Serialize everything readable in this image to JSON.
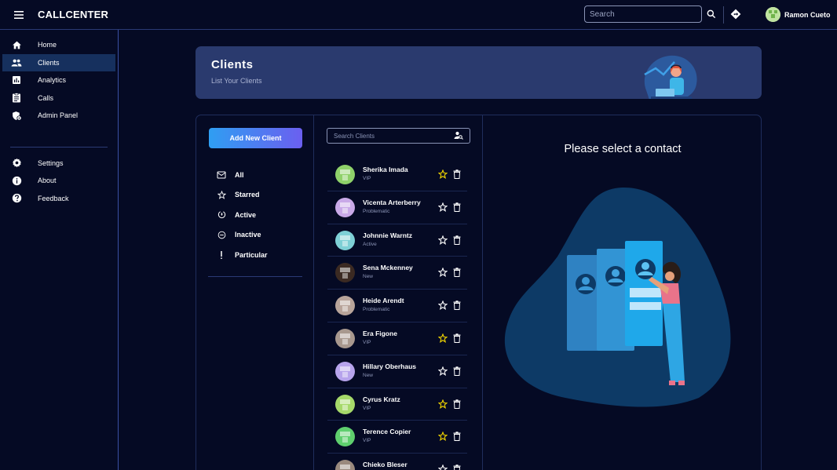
{
  "topbar": {
    "title": "CALLCENTER",
    "search_placeholder": "Search",
    "user_name": "Ramon Cueto"
  },
  "sidebar": {
    "items": [
      {
        "label": "Home",
        "icon": "home-icon"
      },
      {
        "label": "Clients",
        "icon": "people-icon",
        "active": true
      },
      {
        "label": "Analytics",
        "icon": "chart-icon"
      },
      {
        "label": "Calls",
        "icon": "clipboard-icon"
      },
      {
        "label": "Admin Panel",
        "icon": "admin-shield-icon"
      }
    ],
    "bottom_items": [
      {
        "label": "Settings",
        "icon": "gear-icon"
      },
      {
        "label": "About",
        "icon": "info-icon"
      },
      {
        "label": "Feedback",
        "icon": "help-icon"
      }
    ]
  },
  "banner": {
    "title": "Clients",
    "subtitle": "List Your Clients"
  },
  "left_panel": {
    "add_button": "Add New Client",
    "filters": [
      {
        "label": "All",
        "icon": "mail-icon"
      },
      {
        "label": "Starred",
        "icon": "star-icon"
      },
      {
        "label": "Active",
        "icon": "active-icon"
      },
      {
        "label": "Inactive",
        "icon": "minus-circle-icon"
      },
      {
        "label": "Particular",
        "icon": "exclamation-icon"
      }
    ]
  },
  "client_search_placeholder": "Search Clients",
  "clients": [
    {
      "name": "Sherika Imada",
      "status": "VIP",
      "starred": true,
      "avatar_color": "#8fd16a"
    },
    {
      "name": "Vicenta Arterberry",
      "status": "Problematic",
      "starred": false,
      "avatar_color": "#c9a9e8"
    },
    {
      "name": "Johnnie Warntz",
      "status": "Active",
      "starred": false,
      "avatar_color": "#7ed0d6"
    },
    {
      "name": "Sena Mckenney",
      "status": "New",
      "starred": false,
      "avatar_color": "#3b2a22"
    },
    {
      "name": "Heide Arendt",
      "status": "Problematic",
      "starred": false,
      "avatar_color": "#b8a49a"
    },
    {
      "name": "Era Figone",
      "status": "VIP",
      "starred": true,
      "avatar_color": "#a8988e"
    },
    {
      "name": "Hillary Oberhaus",
      "status": "New",
      "starred": false,
      "avatar_color": "#b7a4ec"
    },
    {
      "name": "Cyrus Kratz",
      "status": "VIP",
      "starred": true,
      "avatar_color": "#a6d96a"
    },
    {
      "name": "Terence Copier",
      "status": "VIP",
      "starred": true,
      "avatar_color": "#5fcf6e"
    },
    {
      "name": "Chieko Bleser",
      "status": "",
      "starred": false,
      "avatar_color": "#9a8a7e"
    }
  ],
  "contact_view": {
    "message": "Please select a contact"
  },
  "colors": {
    "background": "#050a24",
    "banner": "#2a3a6e",
    "active_nav": "#16305e",
    "star_active": "#f2d600",
    "accent_start": "#2f9ef2",
    "accent_end": "#6b5ff0"
  }
}
